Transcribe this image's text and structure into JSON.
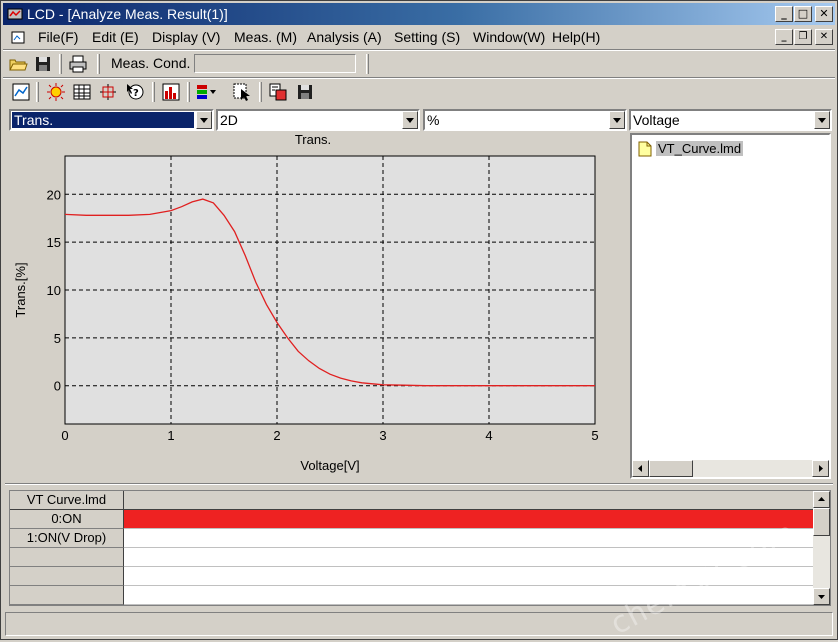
{
  "window": {
    "title": "LCD - [Analyze Meas. Result(1)]",
    "caption_buttons": [
      "minimize",
      "maximize",
      "close"
    ]
  },
  "menu": {
    "items": [
      "File(F)",
      "Edit (E)",
      "Display (V)",
      "Meas. (M)",
      "Analysis (A)",
      "Setting (S)",
      "Window(W)",
      "Help(H)"
    ]
  },
  "toolbar1": {
    "icons": [
      "open-folder-icon",
      "save-disk-icon",
      "print-icon"
    ],
    "meas_cond_label": "Meas. Cond.",
    "meas_cond_value": ""
  },
  "toolbar2": {
    "icons": [
      "graph-view-icon",
      "highlight-icon",
      "table-icon",
      "grid-icon",
      "help-cursor-icon",
      "bar-chart-icon",
      "color-chart-icon",
      "pointer-select-icon",
      "export-icon",
      "save-disk-icon"
    ]
  },
  "combos": {
    "item": "Trans.",
    "dimension": "2D",
    "unit": "%",
    "x_axis": "Voltage"
  },
  "chart_data": {
    "type": "line",
    "title": "Trans.",
    "xlabel": "Voltage[V]",
    "ylabel": "Trans.[%]",
    "xlim": [
      0,
      5
    ],
    "ylim": [
      -4,
      24
    ],
    "xticks": [
      "0",
      "1",
      "2",
      "3",
      "4",
      "5"
    ],
    "yticks": [
      "0",
      "5",
      "10",
      "15",
      "20"
    ],
    "grid": true,
    "series": [
      {
        "color": "#e02020",
        "x": [
          0,
          0.2,
          0.4,
          0.6,
          0.8,
          1.0,
          1.1,
          1.2,
          1.3,
          1.4,
          1.5,
          1.6,
          1.7,
          1.8,
          1.9,
          2.0,
          2.1,
          2.2,
          2.3,
          2.4,
          2.5,
          2.6,
          2.7,
          2.8,
          2.9,
          3.0,
          3.2,
          3.4,
          3.6,
          3.8,
          4.0,
          4.5,
          5.0
        ],
        "y": [
          17.9,
          17.8,
          17.8,
          17.8,
          17.9,
          18.3,
          18.7,
          19.2,
          19.5,
          19.1,
          17.8,
          16.1,
          13.6,
          10.8,
          8.5,
          6.6,
          5.0,
          3.6,
          2.6,
          1.8,
          1.2,
          0.8,
          0.5,
          0.3,
          0.2,
          0.1,
          0.05,
          0.0,
          0.0,
          0.0,
          0.0,
          0.0,
          0.0
        ]
      }
    ]
  },
  "tree": {
    "items": [
      "VT_Curve.lmd"
    ]
  },
  "grid": {
    "header": "VT Curve.lmd",
    "rows": [
      "0:ON",
      "1:ON(V Drop)",
      "",
      "",
      ""
    ],
    "row_colors": [
      "#ee2222",
      "#ffffff",
      "#ffffff",
      "#ffffff",
      "#ffffff"
    ]
  },
  "watermark": "chem17.com"
}
